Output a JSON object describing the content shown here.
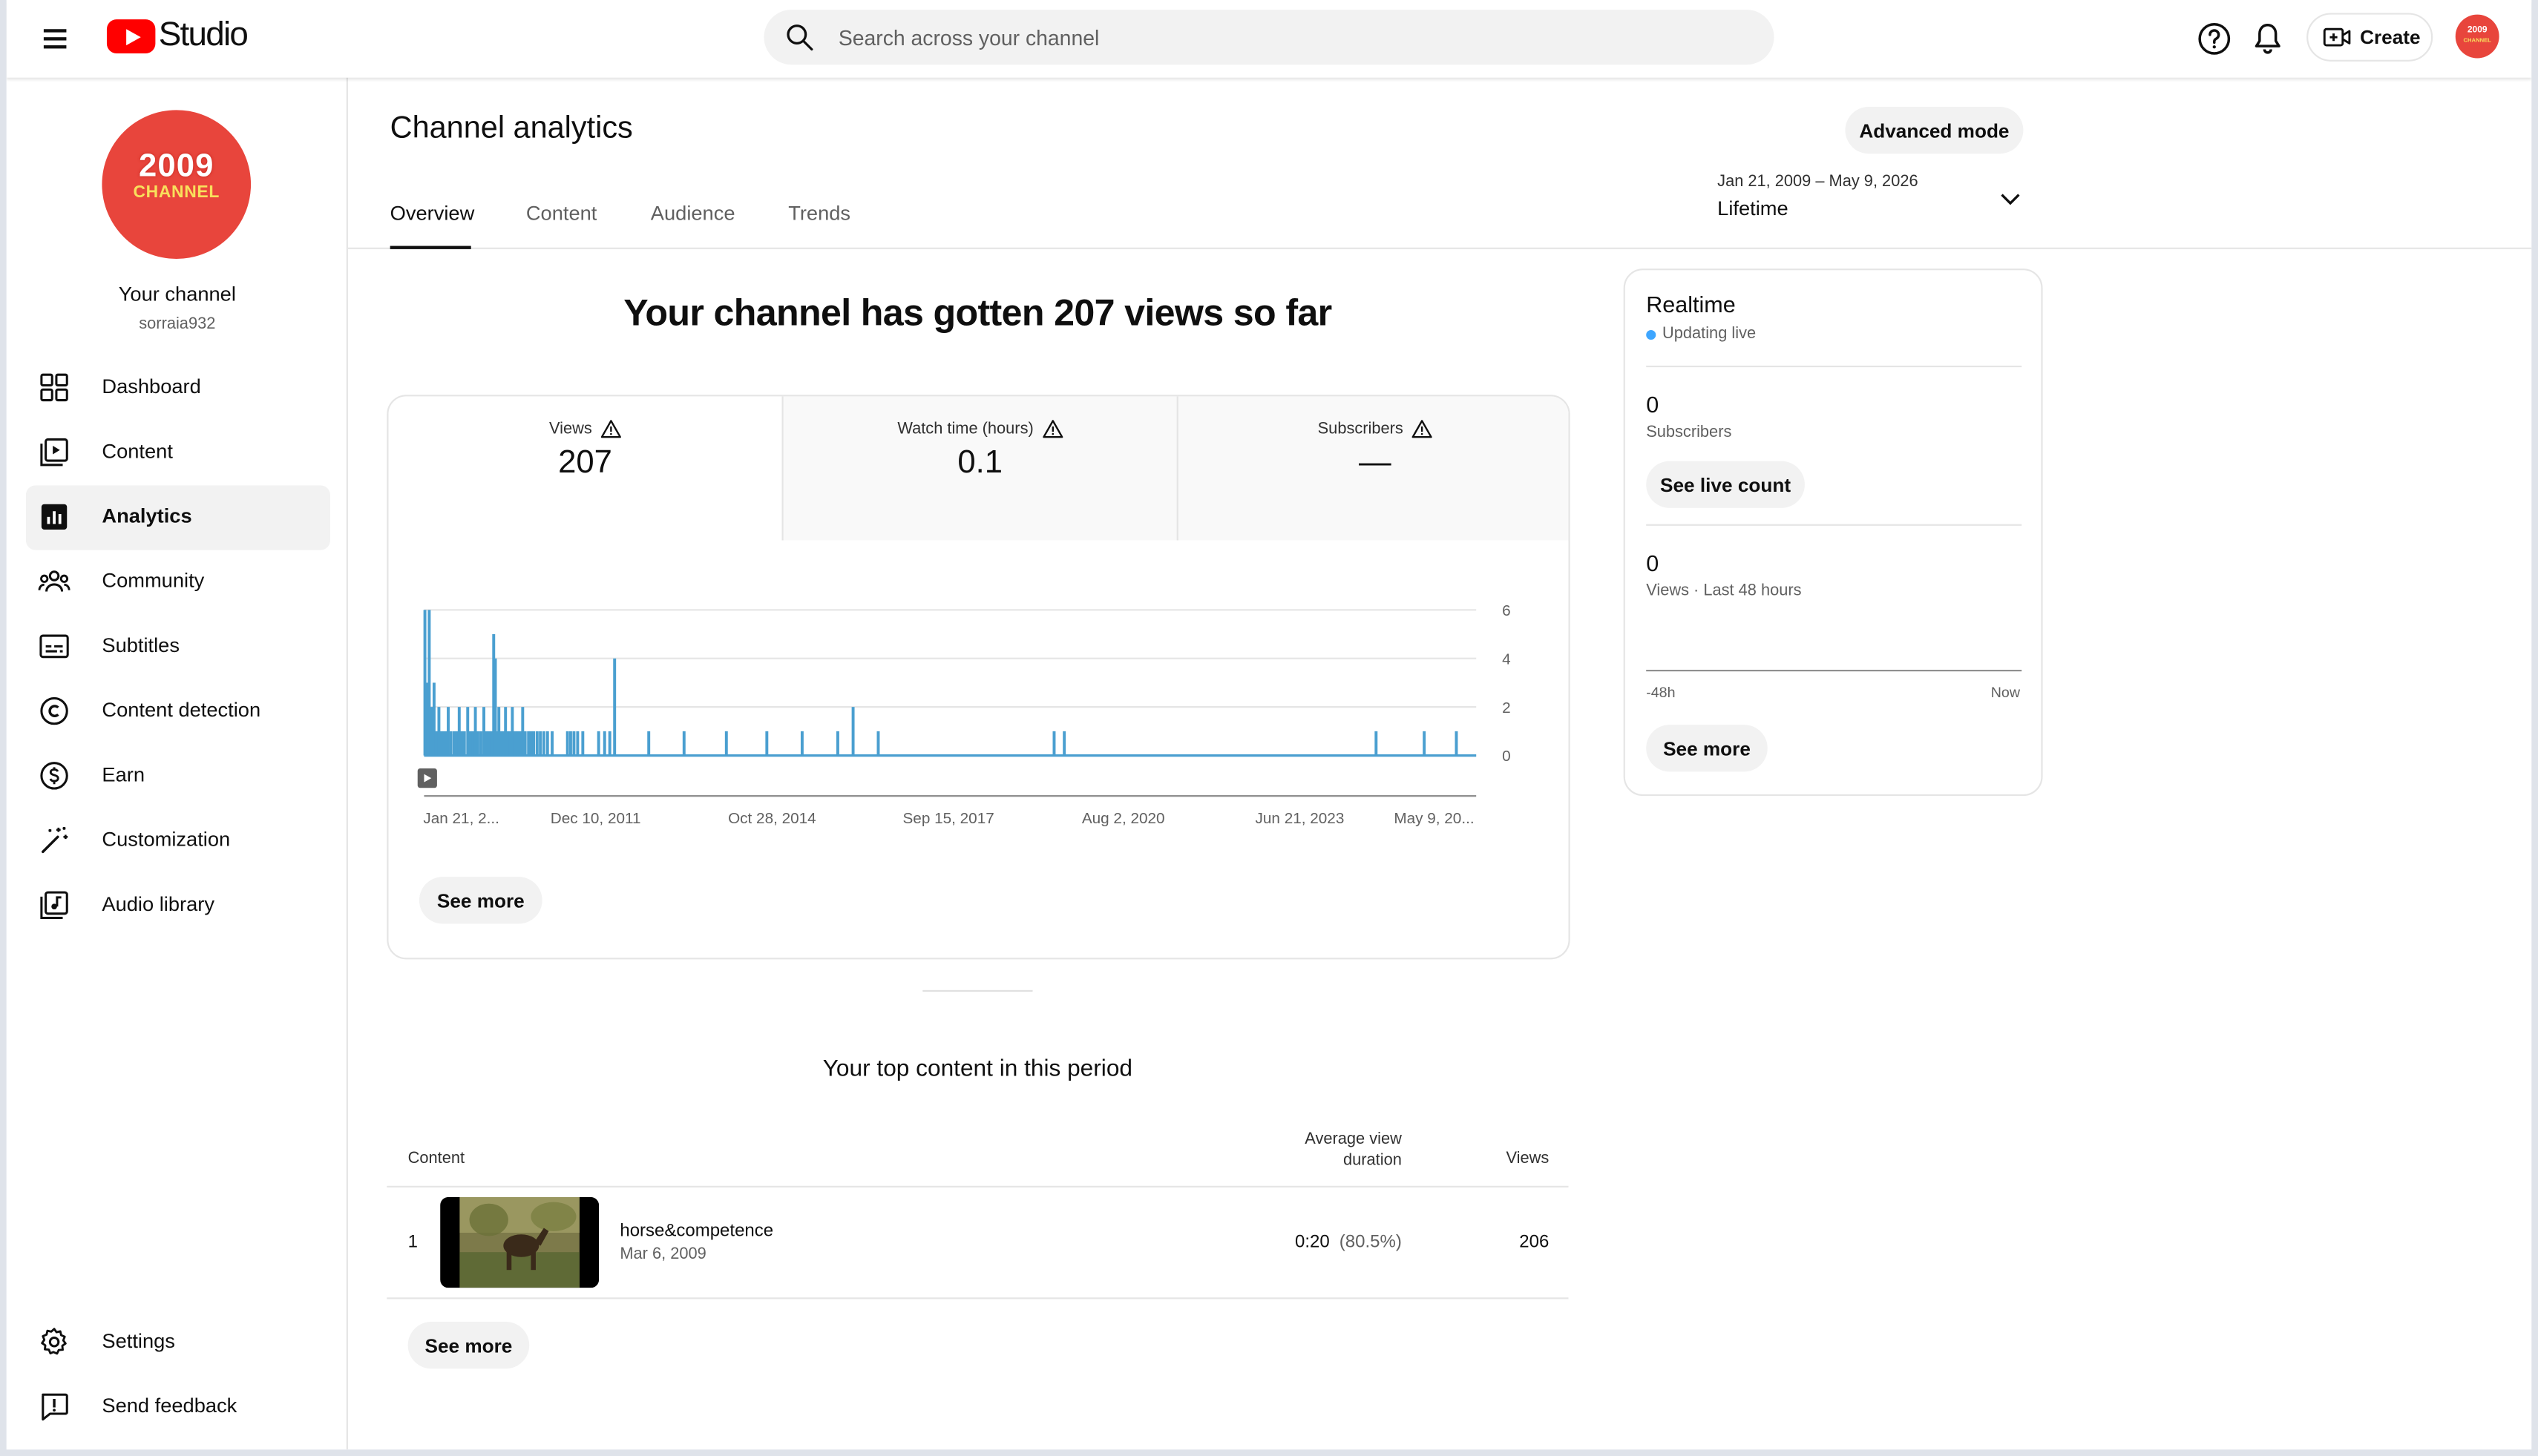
{
  "header": {
    "app_name": "Studio",
    "search_placeholder": "Search across your channel",
    "create_label": "Create",
    "avatar_text_1": "2009",
    "avatar_text_2": "CHANNEL"
  },
  "sidebar": {
    "channel_name": "Your channel",
    "channel_handle": "sorraia932",
    "avatar_line1": "2009",
    "avatar_line2": "CHANNEL",
    "items": [
      {
        "label": "Dashboard",
        "icon": "dashboard-icon"
      },
      {
        "label": "Content",
        "icon": "content-icon"
      },
      {
        "label": "Analytics",
        "icon": "analytics-icon",
        "active": true
      },
      {
        "label": "Community",
        "icon": "community-icon"
      },
      {
        "label": "Subtitles",
        "icon": "subtitles-icon"
      },
      {
        "label": "Content detection",
        "icon": "copyright-icon"
      },
      {
        "label": "Earn",
        "icon": "earn-icon"
      },
      {
        "label": "Customization",
        "icon": "customization-icon"
      },
      {
        "label": "Audio library",
        "icon": "audio-library-icon"
      }
    ],
    "bottom_items": [
      {
        "label": "Settings",
        "icon": "gear-icon"
      },
      {
        "label": "Send feedback",
        "icon": "feedback-icon"
      }
    ]
  },
  "main": {
    "title": "Channel analytics",
    "advanced_mode_label": "Advanced mode",
    "date_range": {
      "range": "Jan 21, 2009 – May 9, 2026",
      "label": "Lifetime"
    },
    "tabs": [
      {
        "label": "Overview",
        "active": true
      },
      {
        "label": "Content"
      },
      {
        "label": "Audience"
      },
      {
        "label": "Trends"
      }
    ],
    "headline": "Your channel has gotten 207 views so far",
    "metrics": [
      {
        "label": "Views",
        "value": "207"
      },
      {
        "label": "Watch time (hours)",
        "value": "0.1"
      },
      {
        "label": "Subscribers",
        "value": "—"
      }
    ],
    "see_more_label": "See more",
    "top_content": {
      "title": "Your top content in this period",
      "col_content": "Content",
      "col_avd_1": "Average view",
      "col_avd_2": "duration",
      "col_views": "Views",
      "rows": [
        {
          "rank": "1",
          "title": "horse&competence",
          "date": "Mar 6, 2009",
          "avd": "0:20",
          "avd_pct": "(80.5%)",
          "views": "206"
        }
      ],
      "see_more_label": "See more"
    }
  },
  "realtime": {
    "title": "Realtime",
    "status": "Updating live",
    "subscribers_value": "0",
    "subscribers_label": "Subscribers",
    "live_count_label": "See live count",
    "views_value": "0",
    "views_label": "Views · Last 48 hours",
    "tick_start": "-48h",
    "tick_end": "Now",
    "see_more_label": "See more"
  },
  "colors": {
    "accent": "#4a9fd0",
    "brand": "#ff0000",
    "avatar": "#e8453c"
  },
  "chart_data": {
    "type": "bar",
    "title": "",
    "ylim": [
      0,
      6
    ],
    "yticks": [
      0,
      2,
      4,
      6
    ],
    "x_tick_labels": [
      "Jan 21, 2...",
      "Dec 10, 2011",
      "Oct 28, 2014",
      "Sep 15, 2017",
      "Aug 2, 2020",
      "Jun 21, 2023",
      "May 9, 20..."
    ],
    "x_range": [
      "2009-01-21",
      "2026-05-09"
    ],
    "series": [
      {
        "values": [
          [
            "2009-01-26",
            6
          ],
          [
            "2009-02-01",
            1
          ],
          [
            "2009-02-08",
            3
          ],
          [
            "2009-02-14",
            1
          ],
          [
            "2009-02-21",
            6
          ],
          [
            "2009-03-01",
            1
          ],
          [
            "2009-03-08",
            2
          ],
          [
            "2009-03-15",
            1
          ],
          [
            "2009-03-22",
            3
          ],
          [
            "2009-04-01",
            1
          ],
          [
            "2009-04-10",
            1
          ],
          [
            "2009-04-20",
            2
          ],
          [
            "2009-05-01",
            1
          ],
          [
            "2009-05-15",
            1
          ],
          [
            "2009-06-01",
            1
          ],
          [
            "2009-06-15",
            2
          ],
          [
            "2009-07-01",
            1
          ],
          [
            "2009-07-20",
            1
          ],
          [
            "2009-08-05",
            1
          ],
          [
            "2009-08-20",
            2
          ],
          [
            "2009-09-05",
            1
          ],
          [
            "2009-09-20",
            1
          ],
          [
            "2009-10-10",
            2
          ],
          [
            "2009-10-25",
            1
          ],
          [
            "2009-11-10",
            1
          ],
          [
            "2009-11-25",
            2
          ],
          [
            "2009-12-10",
            1
          ],
          [
            "2009-12-28",
            1
          ],
          [
            "2010-01-15",
            2
          ],
          [
            "2010-02-01",
            1
          ],
          [
            "2010-02-15",
            1
          ],
          [
            "2010-03-01",
            1
          ],
          [
            "2010-03-15",
            5
          ],
          [
            "2010-03-25",
            4
          ],
          [
            "2010-04-05",
            1
          ],
          [
            "2010-04-15",
            2
          ],
          [
            "2010-04-28",
            1
          ],
          [
            "2010-05-10",
            1
          ],
          [
            "2010-05-25",
            2
          ],
          [
            "2010-06-05",
            1
          ],
          [
            "2010-06-20",
            1
          ],
          [
            "2010-07-05",
            2
          ],
          [
            "2010-07-20",
            1
          ],
          [
            "2010-08-05",
            1
          ],
          [
            "2010-08-20",
            1
          ],
          [
            "2010-09-05",
            2
          ],
          [
            "2010-09-20",
            1
          ],
          [
            "2010-10-10",
            1
          ],
          [
            "2010-10-25",
            1
          ],
          [
            "2010-11-10",
            1
          ],
          [
            "2010-12-01",
            1
          ],
          [
            "2010-12-20",
            1
          ],
          [
            "2011-01-10",
            1
          ],
          [
            "2011-02-01",
            1
          ],
          [
            "2011-03-01",
            1
          ],
          [
            "2011-06-01",
            1
          ],
          [
            "2011-06-20",
            1
          ],
          [
            "2011-07-10",
            1
          ],
          [
            "2011-08-01",
            1
          ],
          [
            "2011-09-01",
            1
          ],
          [
            "2011-12-05",
            1
          ],
          [
            "2012-01-10",
            1
          ],
          [
            "2012-02-10",
            1
          ],
          [
            "2012-03-10",
            4
          ],
          [
            "2012-10-01",
            1
          ],
          [
            "2013-05-01",
            1
          ],
          [
            "2014-01-10",
            1
          ],
          [
            "2014-09-10",
            1
          ],
          [
            "2015-04-10",
            1
          ],
          [
            "2015-11-10",
            1
          ],
          [
            "2016-02-10",
            2
          ],
          [
            "2016-07-10",
            1
          ],
          [
            "2019-06-01",
            1
          ],
          [
            "2019-08-01",
            1
          ],
          [
            "2024-09-15",
            1
          ],
          [
            "2025-07-01",
            1
          ],
          [
            "2026-01-10",
            1
          ]
        ]
      }
    ]
  }
}
